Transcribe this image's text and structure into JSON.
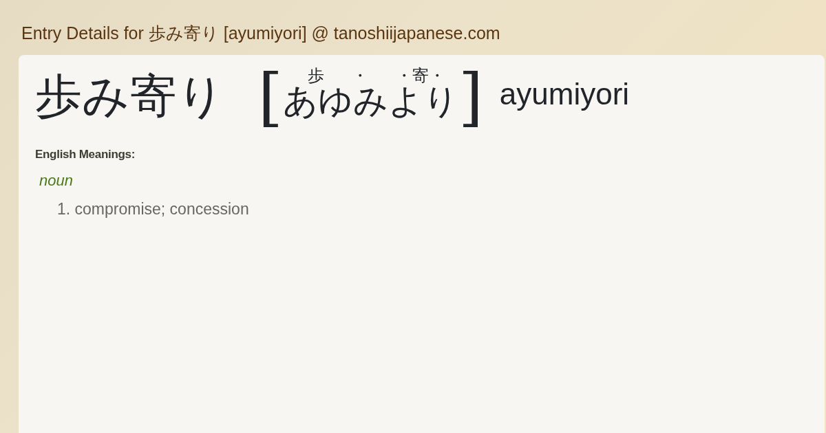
{
  "page_title": "Entry Details for 歩み寄り [ayumiyori] @ tanoshiijapanese.com",
  "entry": {
    "word": "歩み寄り",
    "bracket_open": "[",
    "bracket_close": "]",
    "reading": "あゆみより",
    "furigana": [
      "歩",
      "・",
      "・寄・"
    ],
    "romaji": "ayumiyori"
  },
  "meanings_label": "English Meanings:",
  "part_of_speech": "noun",
  "meanings": [
    {
      "number": "1.",
      "text": "compromise; concession"
    }
  ]
}
